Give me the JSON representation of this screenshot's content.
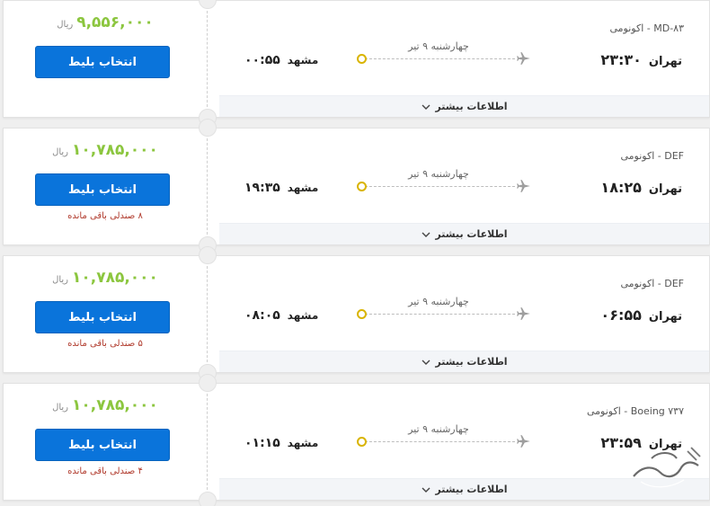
{
  "common": {
    "currency": "ریال",
    "select_label": "انتخاب بلیط",
    "more_info_label": "اطلاعات بیشتر",
    "date_label": "چهارشنبه ۹ تیر",
    "origin_city": "تهران",
    "dest_city": "مشهد",
    "price_color": "#8cc63f",
    "button_color": "#0a74db"
  },
  "flights": [
    {
      "price": "۹,۵۵۶,۰۰۰",
      "aircraft": "MD-۸۳ - اکونومی",
      "origin_time": "۲۳:۳۰",
      "dest_time": "۰۰:۵۵",
      "seats": ""
    },
    {
      "price": "۱۰,۷۸۵,۰۰۰",
      "aircraft": "DEF - اکونومی",
      "origin_time": "۱۸:۲۵",
      "dest_time": "۱۹:۳۵",
      "seats": "۸ صندلی باقی مانده"
    },
    {
      "price": "۱۰,۷۸۵,۰۰۰",
      "aircraft": "DEF - اکونومی",
      "origin_time": "۰۶:۵۵",
      "dest_time": "۰۸:۰۵",
      "seats": "۵ صندلی باقی مانده"
    },
    {
      "price": "۱۰,۷۸۵,۰۰۰",
      "aircraft": "Boeing ۷۳۷ - اکونومی",
      "origin_time": "۲۳:۵۹",
      "dest_time": "۰۱:۱۵",
      "seats": "۴ صندلی باقی مانده"
    }
  ]
}
